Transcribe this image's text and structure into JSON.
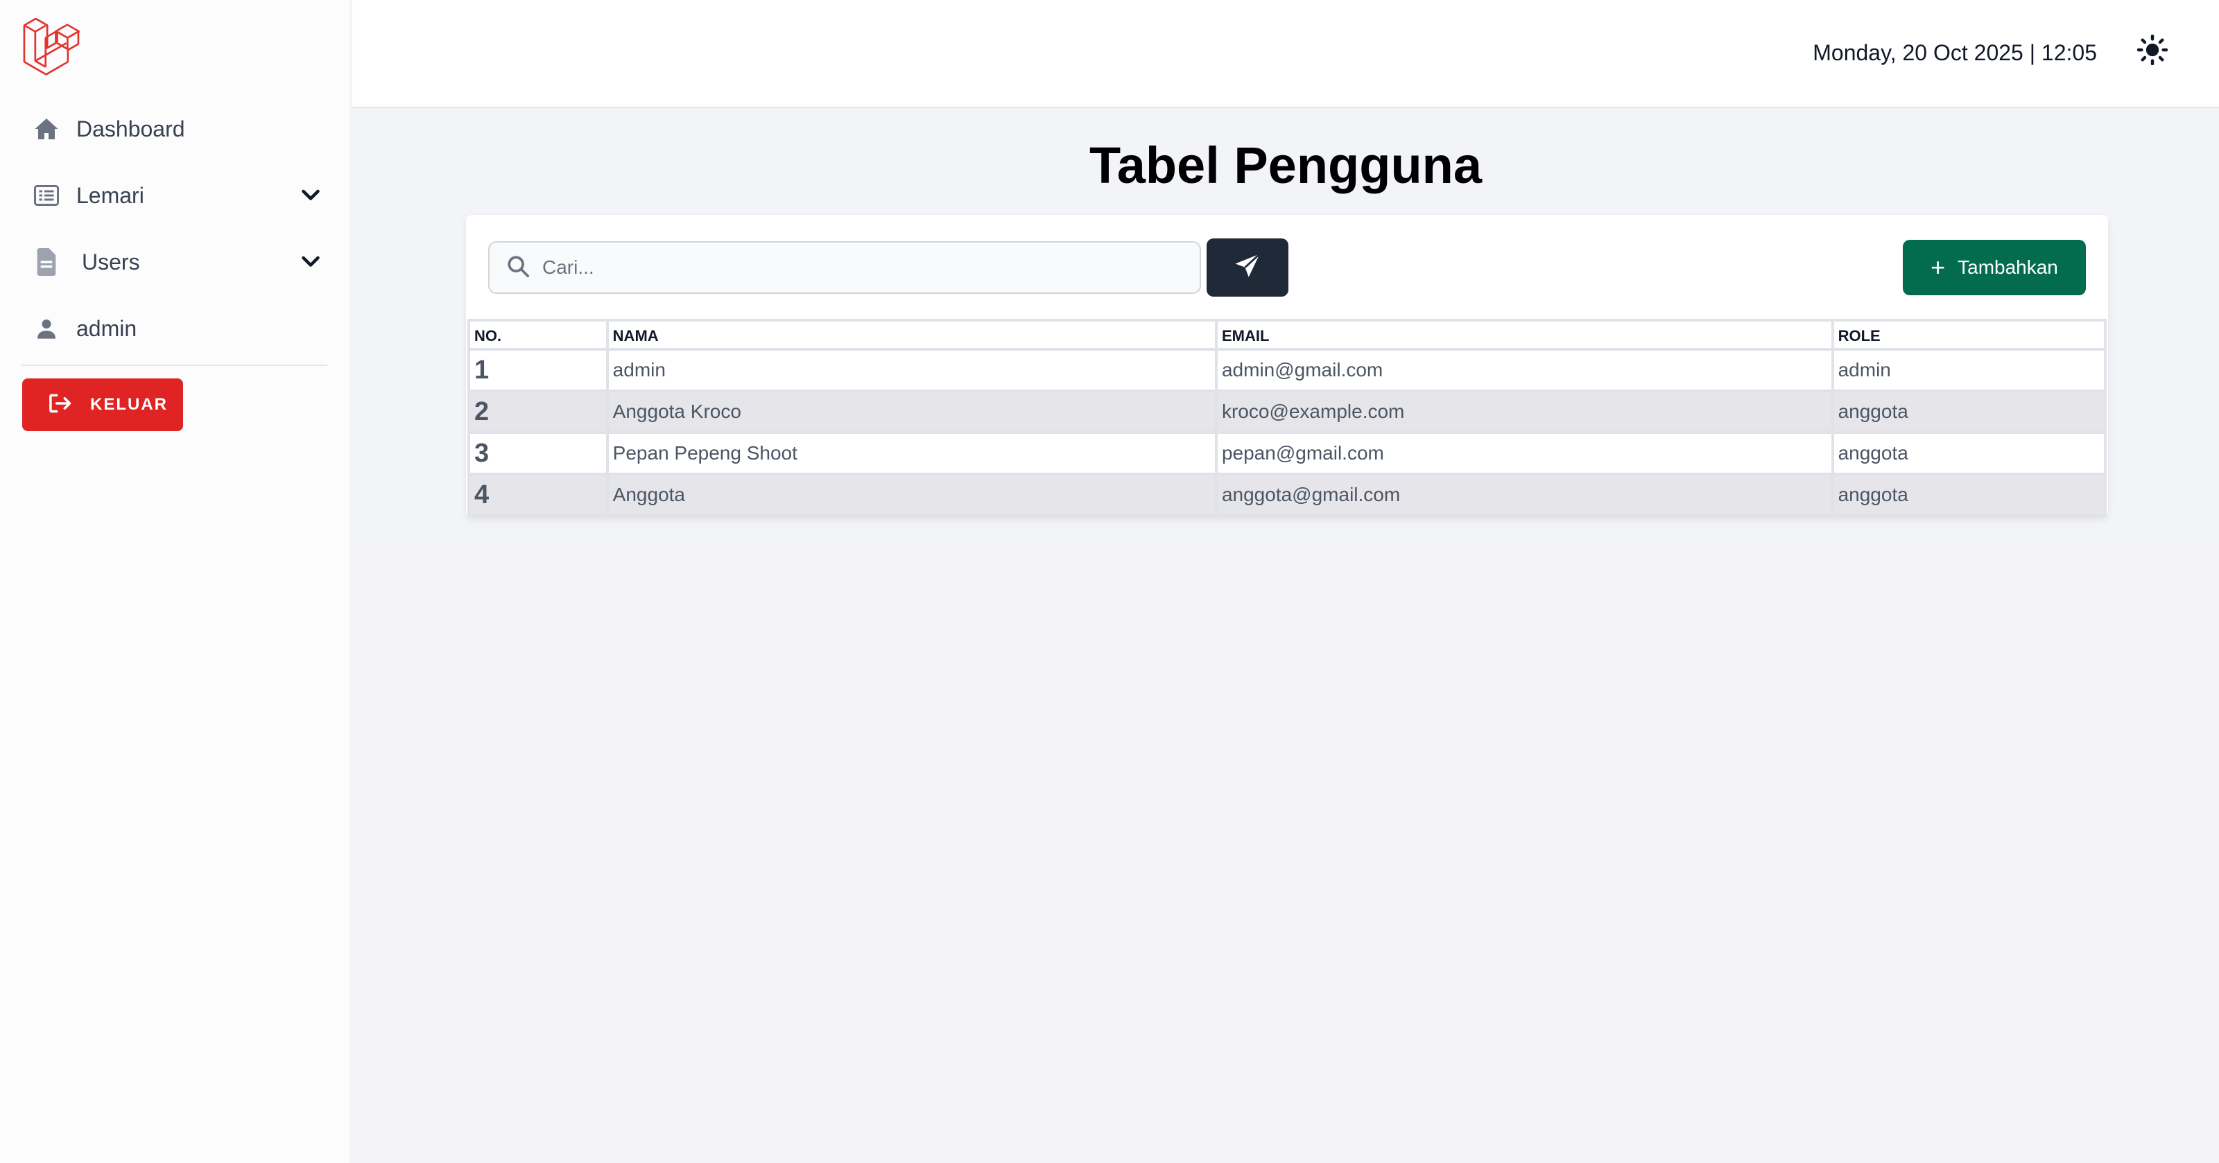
{
  "sidebar": {
    "logo_icon": "laravel-logo-icon",
    "items": [
      {
        "label": "Dashboard",
        "icon": "home-icon"
      },
      {
        "label": "Lemari",
        "icon": "list-icon",
        "expandable": true
      },
      {
        "label": "Users",
        "icon": "document-icon",
        "expandable": true
      },
      {
        "label": "admin",
        "icon": "user-icon"
      }
    ],
    "logout_label": "KELUAR",
    "logout_icon": "logout-icon",
    "logout_color": "#e02424"
  },
  "header": {
    "datetime": "Monday, 20 Oct 2025 | 12:05",
    "theme_icon": "sun-icon"
  },
  "main": {
    "title": "Tabel Pengguna",
    "search": {
      "placeholder": "Cari...",
      "value": ""
    },
    "send_icon": "send-icon",
    "add_label": "Tambahkan",
    "add_color": "#046c4e",
    "table": {
      "headers": [
        "NO.",
        "NAMA",
        "EMAIL",
        "ROLE"
      ],
      "rows": [
        {
          "no": "1",
          "nama": "admin",
          "email": "admin@gmail.com",
          "role": "admin"
        },
        {
          "no": "2",
          "nama": "Anggota Kroco",
          "email": "kroco@example.com",
          "role": "anggota"
        },
        {
          "no": "3",
          "nama": "Pepan Pepeng Shoot",
          "email": "pepan@gmail.com",
          "role": "anggota"
        },
        {
          "no": "4",
          "nama": "Anggota",
          "email": "anggota@gmail.com",
          "role": "anggota"
        }
      ]
    }
  }
}
